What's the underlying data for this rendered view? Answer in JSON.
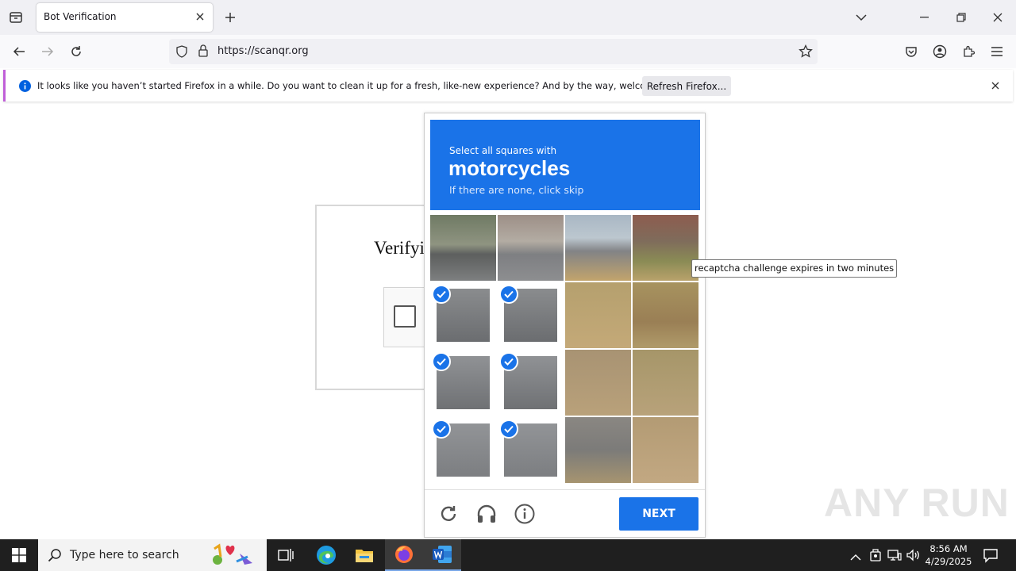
{
  "browser": {
    "tab_title": "Bot Verification",
    "url": "https://scanqr.org",
    "notification": {
      "message": "It looks like you haven’t started Firefox in a while. Do you want to clean it up for a fresh, like-new experience? And by the way, welcome back!",
      "button": "Refresh Firefox..."
    }
  },
  "page": {
    "heading": "Verifyi"
  },
  "captcha": {
    "instruction": "Select all squares with",
    "target": "motorcycles",
    "hint": "If there are none, click skip",
    "next_label": "NEXT",
    "selected_tiles": [
      4,
      5,
      8,
      9,
      12,
      13
    ],
    "tooltip": "recaptcha challenge expires in two minutes"
  },
  "taskbar": {
    "search_placeholder": "Type here to search",
    "time": "8:56 AM",
    "date": "4/29/2025"
  },
  "watermark": "ANY RUN",
  "colors": {
    "accent": "#1a73e8",
    "notification_stripe": "#c05fd8"
  }
}
